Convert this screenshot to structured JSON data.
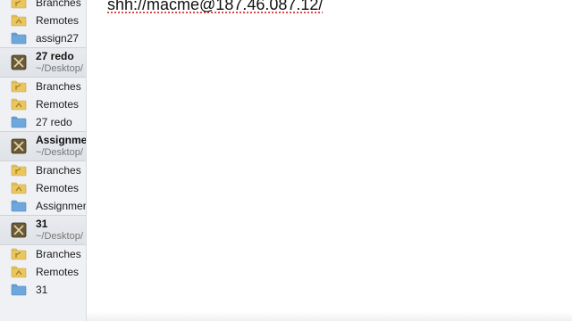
{
  "sidebar": {
    "rows": [
      {
        "kind": "child",
        "icon": "branches-folder-icon",
        "label": "Branches"
      },
      {
        "kind": "child",
        "icon": "remotes-folder-icon",
        "label": "Remotes"
      },
      {
        "kind": "child",
        "icon": "folder-icon",
        "label": "assign27"
      },
      {
        "kind": "repo",
        "icon": "repository-icon",
        "name": "27 redo",
        "path": "~/Desktop/"
      },
      {
        "kind": "child",
        "icon": "branches-folder-icon",
        "label": "Branches"
      },
      {
        "kind": "child",
        "icon": "remotes-folder-icon",
        "label": "Remotes"
      },
      {
        "kind": "child",
        "icon": "folder-icon",
        "label": "27 redo"
      },
      {
        "kind": "repo",
        "icon": "repository-icon",
        "name": "Assignment",
        "path": "~/Desktop/"
      },
      {
        "kind": "child",
        "icon": "branches-folder-icon",
        "label": "Branches"
      },
      {
        "kind": "child",
        "icon": "remotes-folder-icon",
        "label": "Remotes"
      },
      {
        "kind": "child",
        "icon": "folder-icon",
        "label": "Assignment"
      },
      {
        "kind": "repo",
        "icon": "repository-icon",
        "name": "31",
        "path": "~/Desktop/"
      },
      {
        "kind": "child",
        "icon": "branches-folder-icon",
        "label": "Branches"
      },
      {
        "kind": "child",
        "icon": "remotes-folder-icon",
        "label": "Remotes"
      },
      {
        "kind": "child",
        "icon": "folder-icon",
        "label": "31"
      }
    ]
  },
  "main": {
    "remote_url": "shh://macme@187.46.087.12/"
  },
  "colors": {
    "sidebar_bg": "#eff1f5",
    "folder_blue": "#6fa6dc",
    "folder_yellow": "#e9c660",
    "spellcheck_underline": "#d0312d"
  }
}
